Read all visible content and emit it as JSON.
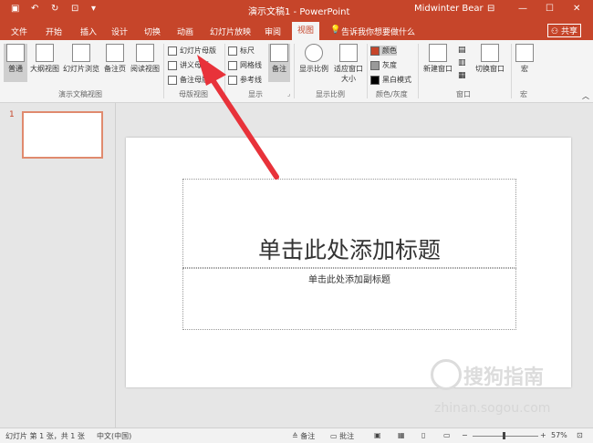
{
  "titlebar": {
    "doc_title": "演示文稿1 - PowerPoint",
    "user": "Midwinter Bear",
    "minimize": "—",
    "maximize": "☐",
    "close": "✕"
  },
  "tabs": [
    "文件",
    "开始",
    "插入",
    "设计",
    "切换",
    "动画",
    "幻灯片放映",
    "审阅",
    "视图"
  ],
  "tell_me": "告诉我你想要做什么",
  "share": "共享",
  "ribbon": {
    "views": [
      "普通",
      "大纲视图",
      "幻灯片浏览",
      "备注页",
      "阅读视图"
    ],
    "views_group": "演示文稿视图",
    "master": [
      "幻灯片母版",
      "讲义母版",
      "备注母版"
    ],
    "master_group": "母版视图",
    "show": [
      "标尺",
      "网格线",
      "参考线"
    ],
    "show_group": "显示",
    "notes": "备注",
    "zoom": "显示比例",
    "fit": "适应窗口大小",
    "zoom_group": "显示比例",
    "color": [
      "颜色",
      "灰度",
      "黑白模式"
    ],
    "color_group": "颜色/灰度",
    "new_window": "新建窗口",
    "switch_window": "切换窗口",
    "window_group": "窗口",
    "macro": "宏",
    "macro_group": "宏"
  },
  "thumbnail_number": "1",
  "slide": {
    "title_placeholder": "单击此处添加标题",
    "subtitle_placeholder": "单击此处添加副标题"
  },
  "watermark": {
    "name": "搜狗指南",
    "url": "zhinan.sogou.com"
  },
  "status": {
    "slide_info": "幻灯片 第 1 张，共 1 张",
    "language": "中文(中国)",
    "notes": "备注",
    "comments": "批注",
    "zoom": "57%"
  },
  "colors": {
    "accent": "#c6452a",
    "arrow": "#e8323a"
  }
}
